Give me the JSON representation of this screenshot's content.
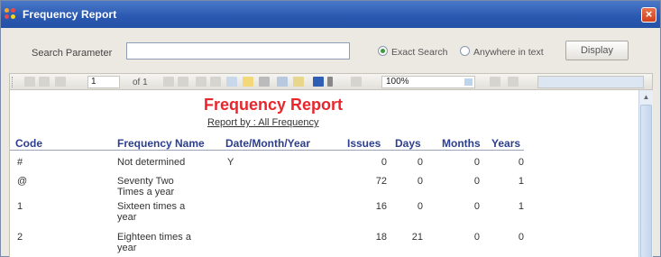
{
  "window": {
    "title": "Frequency Report",
    "close_label": "×"
  },
  "search": {
    "label": "Search Parameter",
    "value": "",
    "placeholder": "",
    "exact_label": "Exact Search",
    "anywhere_label": "Anywhere in text",
    "selected": "exact",
    "display_label": "Display"
  },
  "toolbar": {
    "page": "1",
    "of_label": "of 1",
    "zoom": "100%"
  },
  "report": {
    "title": "Frequency Report",
    "subtitle": "Report by : All Frequency",
    "columns": [
      "Code",
      "Frequency Name",
      "Date/Month/Year",
      "Issues",
      "Days",
      "Months",
      "Years"
    ],
    "rows": [
      {
        "code": "#",
        "name": "Not determined",
        "dmy": "Y",
        "issues": "0",
        "days": "0",
        "months": "0",
        "years": "0"
      },
      {
        "code": "@",
        "name": "Seventy Two Times a year",
        "dmy": "",
        "issues": "72",
        "days": "0",
        "months": "0",
        "years": "1"
      },
      {
        "code": "1",
        "name": "Sixteen times a year",
        "dmy": "",
        "issues": "16",
        "days": "0",
        "months": "0",
        "years": "1"
      },
      {
        "code": "2",
        "name": "Eighteen times a year",
        "dmy": "",
        "issues": "18",
        "days": "21",
        "months": "0",
        "years": "0"
      }
    ]
  },
  "colors": {
    "title_bar": "#2a58b0",
    "report_title": "#e8262b",
    "header_text": "#2c3e8e",
    "radio_dot": "#3c9a3c"
  }
}
